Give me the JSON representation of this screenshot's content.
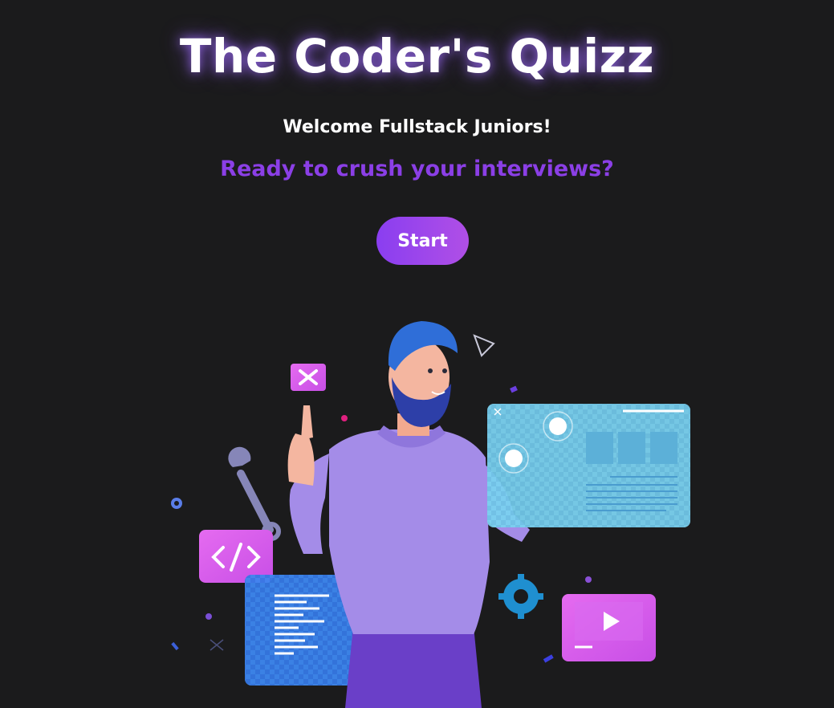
{
  "header": {
    "title": "The Coder's Quizz"
  },
  "intro": {
    "welcome": "Welcome Fullstack Juniors!",
    "tagline": "Ready to crush your interviews?"
  },
  "actions": {
    "start_label": "Start"
  },
  "colors": {
    "background": "#1b1b1c",
    "accent": "#8b3fe6",
    "title_glow": "#a06eff"
  },
  "illustration": {
    "icons": [
      "developer-illustration",
      "code-icon",
      "wrench-icon",
      "close-icon",
      "gear-icon",
      "play-icon"
    ]
  }
}
